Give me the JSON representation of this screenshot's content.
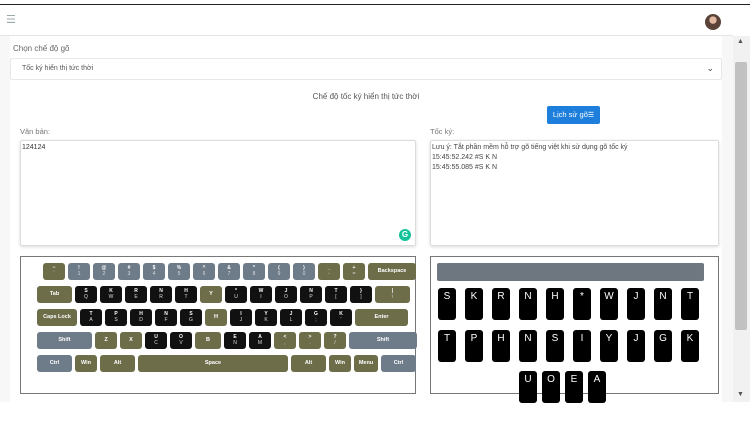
{
  "navbar": {
    "menu_icon": "hamburger-icon",
    "avatar_icon": "user-avatar"
  },
  "mode": {
    "label": "Chọn chế độ gõ",
    "selected": "Tốc ký hiển thị tức thời",
    "chevron_icon": "chevron-down-icon"
  },
  "heading": "Chế độ tốc ký hiển thị tức thời",
  "history_button": {
    "label": "Lịch sử gõ",
    "icon": "list-icon"
  },
  "text_panel": {
    "label": "Văn bản:",
    "value": "124124",
    "grammar_icon": "grammarly-icon"
  },
  "steno_panel": {
    "label": "Tốc ký:",
    "lines": [
      "Lưu ý: Tắt phần mềm hỗ trợ gõ tiếng việt khi sử dụng gõ tốc ký",
      "15:45:52.242 #S K   N",
      "15:45:55.085 #S K   N"
    ]
  },
  "keyboard": {
    "row1": [
      {
        "t": "~",
        "b": "`"
      },
      {
        "t": "!",
        "b": "1"
      },
      {
        "t": "@",
        "b": "2"
      },
      {
        "t": "#",
        "b": "3"
      },
      {
        "t": "$",
        "b": "4"
      },
      {
        "t": "%",
        "b": "5"
      },
      {
        "t": "^",
        "b": "6"
      },
      {
        "t": "&",
        "b": "7"
      },
      {
        "t": "*",
        "b": "8"
      },
      {
        "t": "(",
        "b": "9"
      },
      {
        "t": ")",
        "b": "0"
      },
      {
        "t": "_",
        "b": "-"
      },
      {
        "t": "+",
        "b": "="
      },
      {
        "t": "Backspace",
        "b": ""
      }
    ],
    "row2": [
      {
        "t": "Tab",
        "b": ""
      },
      {
        "t": "S",
        "b": "Q"
      },
      {
        "t": "K",
        "b": "W"
      },
      {
        "t": "R",
        "b": "E"
      },
      {
        "t": "N",
        "b": "R"
      },
      {
        "t": "H",
        "b": "T"
      },
      {
        "t": "Y",
        "b": ""
      },
      {
        "t": "*",
        "b": "U"
      },
      {
        "t": "W",
        "b": "I"
      },
      {
        "t": "J",
        "b": "O"
      },
      {
        "t": "N",
        "b": "P"
      },
      {
        "t": "T",
        "b": "["
      },
      {
        "t": "}",
        "b": "]"
      },
      {
        "t": "|",
        "b": "\\"
      }
    ],
    "row3": [
      {
        "t": "Caps Lock",
        "b": ""
      },
      {
        "t": "T",
        "b": "A"
      },
      {
        "t": "P",
        "b": "S"
      },
      {
        "t": "H",
        "b": "D"
      },
      {
        "t": "N",
        "b": "F"
      },
      {
        "t": "S",
        "b": "G"
      },
      {
        "t": "H",
        "b": ""
      },
      {
        "t": "I",
        "b": "J"
      },
      {
        "t": "Y",
        "b": "K"
      },
      {
        "t": "J",
        "b": "L"
      },
      {
        "t": "G",
        "b": ";"
      },
      {
        "t": "K",
        "b": "'"
      },
      {
        "t": "Enter",
        "b": ""
      }
    ],
    "row4": [
      {
        "t": "Shift",
        "b": ""
      },
      {
        "t": "Z",
        "b": ""
      },
      {
        "t": "X",
        "b": ""
      },
      {
        "t": "U",
        "b": "C"
      },
      {
        "t": "O",
        "b": "V"
      },
      {
        "t": "B",
        "b": ""
      },
      {
        "t": "E",
        "b": "N"
      },
      {
        "t": "A",
        "b": "M"
      },
      {
        "t": "<",
        "b": ","
      },
      {
        "t": ">",
        "b": "."
      },
      {
        "t": "?",
        "b": "/"
      },
      {
        "t": "Shift",
        "b": ""
      }
    ],
    "row5": [
      {
        "t": "Ctrl",
        "b": ""
      },
      {
        "t": "Win",
        "b": ""
      },
      {
        "t": "Alt",
        "b": ""
      },
      {
        "t": "Space",
        "b": ""
      },
      {
        "t": "Alt",
        "b": ""
      },
      {
        "t": "Win",
        "b": ""
      },
      {
        "t": "Menu",
        "b": ""
      },
      {
        "t": "Ctrl",
        "b": ""
      }
    ]
  },
  "steno_keys": {
    "row1": [
      "S",
      "K",
      "R",
      "N",
      "H",
      "*",
      "W",
      "J",
      "N",
      "T"
    ],
    "row2": [
      "T",
      "P",
      "H",
      "N",
      "S",
      "I",
      "Y",
      "J",
      "G",
      "K"
    ],
    "row3": [
      "U",
      "O",
      "E",
      "A"
    ]
  }
}
